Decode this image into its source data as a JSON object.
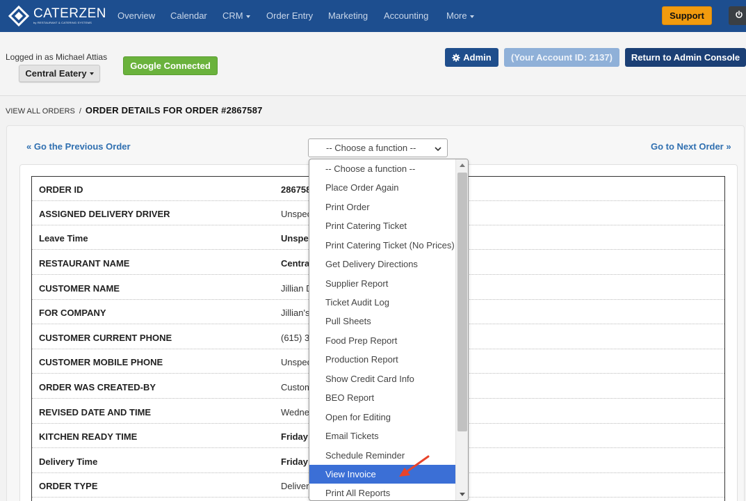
{
  "brand": {
    "name": "CATERZEN",
    "tagline": "by RESTAURANT & CATERING SYSTEMS"
  },
  "nav": {
    "items": [
      {
        "label": "Overview"
      },
      {
        "label": "Calendar"
      },
      {
        "label": "CRM",
        "dropdown": true
      },
      {
        "label": "Order Entry"
      },
      {
        "label": "Marketing"
      },
      {
        "label": "Accounting"
      },
      {
        "label": "More",
        "dropdown": true
      }
    ],
    "support_label": "Support",
    "power_icon": "power-icon"
  },
  "account": {
    "logged_in_text": "Logged in as Michael Attias",
    "location_label": "Central Eatery",
    "google_label": "Google Connected",
    "admin_label": "Admin",
    "account_id_label": "(Your Account ID: 2137)",
    "return_label": "Return to Admin Console"
  },
  "breadcrumb": {
    "link": "VIEW ALL ORDERS",
    "separator": "/",
    "title": "ORDER DETAILS FOR ORDER #2867587"
  },
  "order_nav": {
    "prev_label": "« Go the Previous Order",
    "next_label": "Go to Next Order »",
    "select_value": "-- Choose a function --"
  },
  "details": [
    {
      "label": "ORDER ID",
      "value": "2867587",
      "bold": true
    },
    {
      "label": "ASSIGNED DELIVERY DRIVER",
      "value": "Unspecified",
      "bold": false
    },
    {
      "label": "Leave Time",
      "value": "Unspecified",
      "bold": true
    },
    {
      "label": "RESTAURANT NAME",
      "value": "Central Eatery",
      "bold": true
    },
    {
      "label": "CUSTOMER NAME",
      "value": "Jillian D",
      "bold": false
    },
    {
      "label": "FOR COMPANY",
      "value": "Jillian's",
      "bold": false
    },
    {
      "label": "CUSTOMER CURRENT PHONE",
      "value": "(615) 3",
      "bold": false
    },
    {
      "label": "CUSTOMER MOBILE PHONE",
      "value": "Unspecified",
      "bold": false
    },
    {
      "label": "ORDER WAS CREATED-BY",
      "value": "Customer",
      "bold": false
    },
    {
      "label": "REVISED DATE AND TIME",
      "value": "Wednesday",
      "bold": false
    },
    {
      "label": "KITCHEN READY TIME",
      "value": "Friday",
      "bold": true
    },
    {
      "label": "Delivery Time",
      "value": "Friday",
      "bold": true
    },
    {
      "label": "ORDER TYPE",
      "value": "Delivery",
      "bold": false
    }
  ],
  "function_options": [
    {
      "label": "-- Choose a function --",
      "selected": false
    },
    {
      "label": "Place Order Again",
      "selected": false
    },
    {
      "label": "Print Order",
      "selected": false
    },
    {
      "label": "Print Catering Ticket",
      "selected": false
    },
    {
      "label": "Print Catering Ticket (No Prices)",
      "selected": false
    },
    {
      "label": "Get Delivery Directions",
      "selected": false
    },
    {
      "label": "Supplier Report",
      "selected": false
    },
    {
      "label": "Ticket Audit Log",
      "selected": false
    },
    {
      "label": "Pull Sheets",
      "selected": false
    },
    {
      "label": "Food Prep Report",
      "selected": false
    },
    {
      "label": "Production Report",
      "selected": false
    },
    {
      "label": "Show Credit Card Info",
      "selected": false
    },
    {
      "label": "BEO Report",
      "selected": false
    },
    {
      "label": "Open for Editing",
      "selected": false
    },
    {
      "label": "Email Tickets",
      "selected": false
    },
    {
      "label": "Schedule Reminder",
      "selected": false
    },
    {
      "label": "View Invoice",
      "selected": true
    },
    {
      "label": "Print All Reports",
      "selected": false
    }
  ],
  "colors": {
    "navbar": "#1d4e8f",
    "support": "#f29b0e",
    "google": "#6ab23c",
    "admin": "#1f4e8c",
    "account_id": "#8fb0d8",
    "return": "#1b3f75",
    "link": "#2f6fb0",
    "selected_option": "#3b6fd6",
    "annotation_arrow": "#e8432b"
  },
  "icons": {
    "admin": "gear-icon",
    "logo": "diamond-logo-icon"
  }
}
